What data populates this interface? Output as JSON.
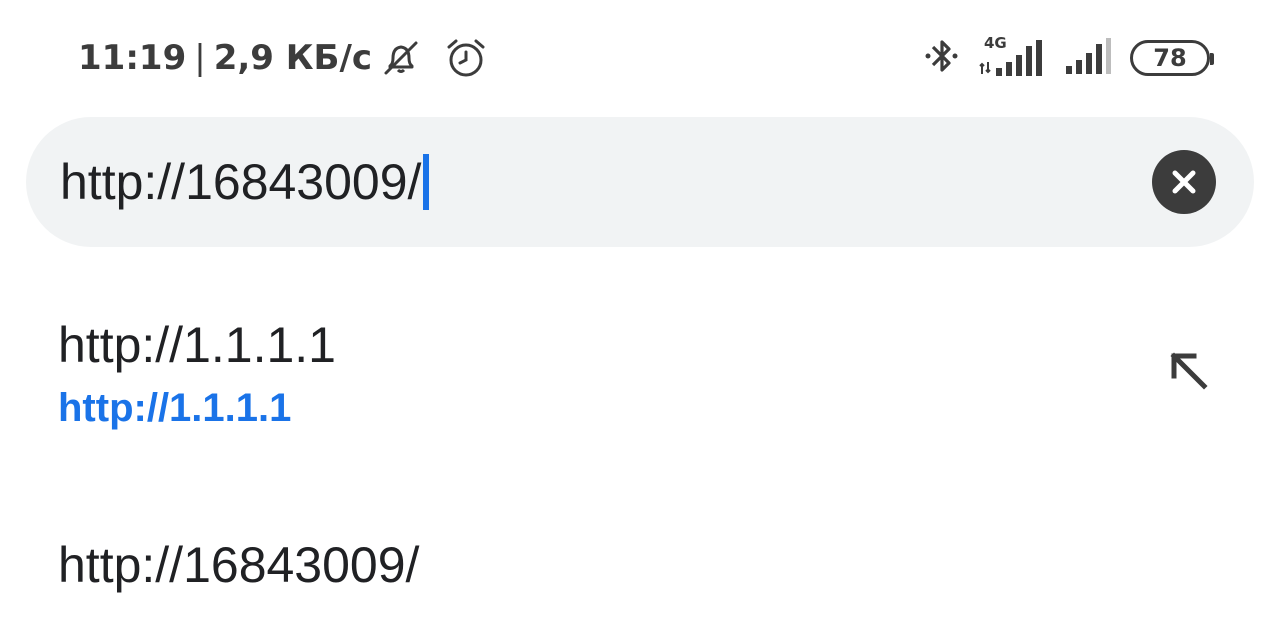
{
  "status_bar": {
    "time": "11:19",
    "separator": "|",
    "net_speed": "2,9 КБ/с",
    "icons": [
      "bell-off-icon",
      "alarm-icon",
      "bluetooth-icon",
      "signal-4g-icon",
      "signal-icon"
    ],
    "network_type": "4G",
    "battery": "78"
  },
  "url_bar": {
    "value": "http://16843009/",
    "clear_icon": "close-icon"
  },
  "suggestions": [
    {
      "title": "http://1.1.1.1",
      "url": "http://1.1.1.1",
      "action_icon": "arrow-up-left-icon"
    },
    {
      "title": "http://16843009/"
    }
  ],
  "colors": {
    "accent": "#1a73e8",
    "url_bar_bg": "#f1f3f4",
    "icon_dark": "#3c3c3c",
    "text": "#202124"
  }
}
